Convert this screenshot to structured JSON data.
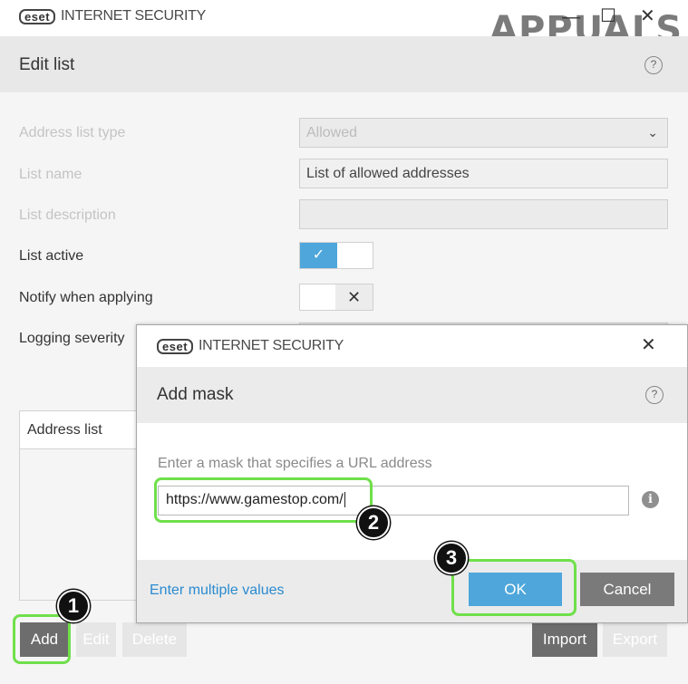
{
  "main_window": {
    "brand_badge": "eset",
    "brand_name": "INTERNET SECURITY",
    "watermark": "APPUALS",
    "minimize_glyph": "—",
    "maximize_glyph": "☐",
    "close_glyph": "✕",
    "page_title": "Edit list",
    "help_glyph": "?",
    "form": {
      "address_list_type_label": "Address list type",
      "address_list_type_value": "Allowed",
      "list_name_label": "List name",
      "list_name_value": "List of allowed addresses",
      "list_description_label": "List description",
      "list_description_value": "",
      "list_active_label": "List active",
      "list_active_on": true,
      "notify_label": "Notify when applying",
      "notify_on": false,
      "logging_severity_label": "Logging severity"
    },
    "address_list_header": "Address list",
    "buttons": {
      "add": "Add",
      "edit": "Edit",
      "delete": "Delete",
      "import": "Import",
      "export": "Export"
    }
  },
  "dialog": {
    "brand_badge": "eset",
    "brand_name": "INTERNET SECURITY",
    "close_glyph": "✕",
    "title": "Add mask",
    "help_glyph": "?",
    "instruction": "Enter a mask that specifies a URL address",
    "url_value": "https://www.gamestop.com/",
    "info_glyph": "i",
    "multiple_values_link": "Enter multiple values",
    "ok_label": "OK",
    "cancel_label": "Cancel"
  },
  "annotations": {
    "step1": "1",
    "step2": "2",
    "step3": "3",
    "highlight_color": "#6fe04a"
  },
  "colors": {
    "accent": "#4ea6db",
    "link": "#2a8bd0",
    "dark_button": "#6d6d6d"
  }
}
